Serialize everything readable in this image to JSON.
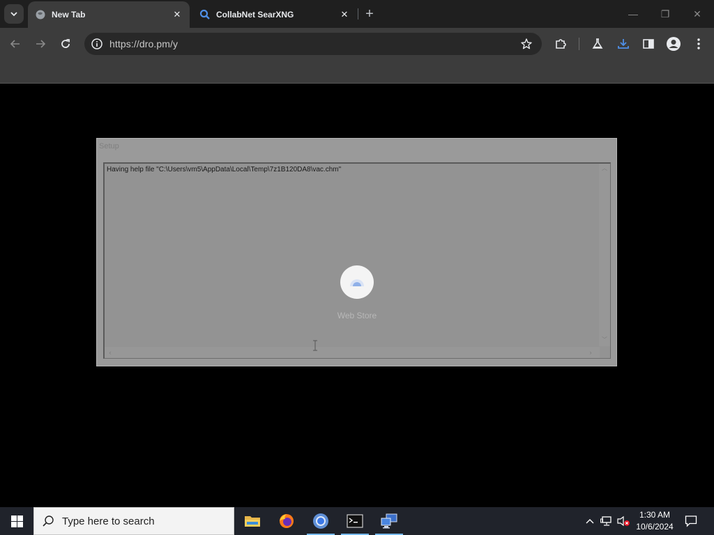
{
  "browser": {
    "tabs": [
      {
        "title": "New Tab",
        "active": true,
        "icon": "globe-icon"
      },
      {
        "title": "CollabNet SearXNG",
        "active": false,
        "icon": "search-icon"
      }
    ],
    "new_tab_label": "+",
    "window_controls": {
      "minimize": "—",
      "restore": "❐",
      "close": "✕"
    },
    "address": {
      "url": "https://dro.pm/y"
    },
    "colors": {
      "tabstrip": "#1f1f1f",
      "toolbar": "#3c3c3c",
      "omnibox": "#282828",
      "download_accent": "#4f8fe6"
    }
  },
  "setup_dialog": {
    "title": "Setup",
    "message": "Having help file \"C:\\Users\\vm5\\AppData\\Local\\Temp\\7z1B120DA8\\vac.chm\""
  },
  "loading_overlay": {
    "label": "Web Store",
    "icon": "web-store-icon"
  },
  "taskbar": {
    "search_placeholder": "Type here to search",
    "apps": [
      {
        "name": "file-explorer",
        "icon": "folder-icon"
      },
      {
        "name": "firefox",
        "icon": "firefox-icon"
      },
      {
        "name": "chrome",
        "icon": "chrome-icon",
        "running": true
      },
      {
        "name": "terminal",
        "icon": "terminal-icon",
        "running": true
      },
      {
        "name": "network-app",
        "icon": "network-computer-icon",
        "running": true
      }
    ],
    "time": "1:30 AM",
    "date": "10/6/2024"
  }
}
